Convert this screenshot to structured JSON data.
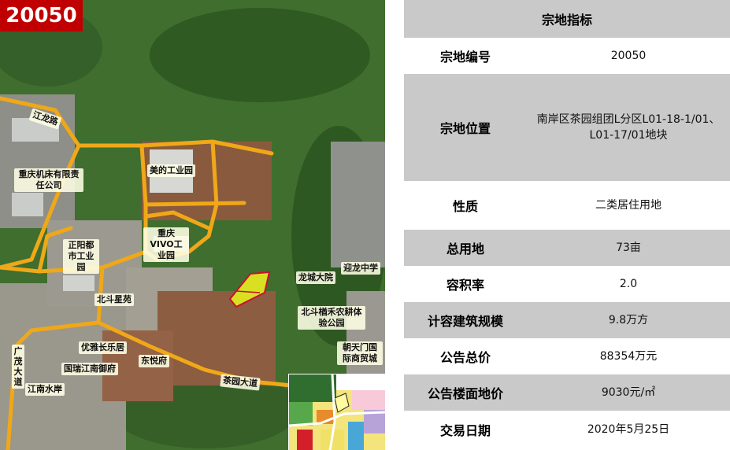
{
  "parcel_badge": "20050",
  "map": {
    "labels": {
      "jianglong_road": "江龙路",
      "chongqing_machine": "重庆机床有限责任公司",
      "midea_park": "美的工业园",
      "vivo_park": "重庆VIVO工业园",
      "zhengyang_park": "正阳都市工业园",
      "beidou_xingyuan": "北斗星苑",
      "longcheng_dayuan": "龙城大院",
      "yinglong_school": "迎龙中学",
      "beidou_farm": "北斗楢禾农耕体验公园",
      "youya_changle": "优雅长乐居",
      "guorui_jiangnan": "国瑞江南御府",
      "dongyue_fu": "东悦府",
      "jiangnan_shuian": "江南水岸",
      "guangmao_avenue": "广茂大道",
      "chayuan_avenue": "茶园大道",
      "chaotianmen_market": "朝天门国际商贸城"
    }
  },
  "table": {
    "header": "宗地指标",
    "rows": [
      {
        "label": "宗地编号",
        "value": "20050"
      },
      {
        "label": "宗地位置",
        "value": "南岸区茶园组团L分区L01-18-1/01、L01-17/01地块"
      },
      {
        "label": "性质",
        "value": "二类居住用地"
      },
      {
        "label": "总用地",
        "value": "73亩"
      },
      {
        "label": "容积率",
        "value": "2.0"
      },
      {
        "label": "计容建筑规模",
        "value": "9.8万方"
      },
      {
        "label": "公告总价",
        "value": "88354万元"
      },
      {
        "label": "公告楼面地价",
        "value": "9030元/㎡"
      },
      {
        "label": "交易日期",
        "value": "2020年5月25日"
      }
    ]
  },
  "colors": {
    "road": "#f0a818",
    "parcel": "#d9e021",
    "table_gray": "#c9c9c9",
    "badge_red": "#c00000"
  }
}
